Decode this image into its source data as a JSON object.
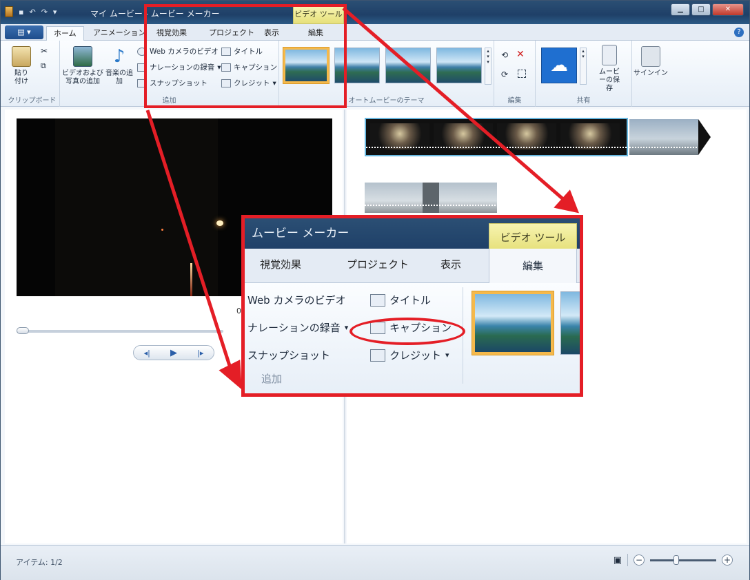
{
  "window": {
    "title": "マイ ムービー - ムービー メーカー",
    "context_tab": "ビデオ ツール"
  },
  "tabs": {
    "file": "▤ ▾",
    "home": "ホーム",
    "animation": "アニメーション",
    "visual_effects": "視覚効果",
    "project": "プロジェクト",
    "view": "表示",
    "edit": "編集"
  },
  "ribbon": {
    "clipboard": {
      "paste": "貼り付け",
      "label": "クリップボード"
    },
    "add": {
      "add_video_photos": "ビデオおよび写真の追加",
      "add_music": "音楽の追加",
      "webcam_video": "Web カメラのビデオ",
      "record_narration": "ナレーションの録音",
      "snapshot": "スナップショット",
      "title": "タイトル",
      "caption": "キャプション",
      "credits": "クレジット",
      "label": "追加"
    },
    "themes": {
      "label": "オートムービーのテーマ"
    },
    "editing": {
      "label": "編集"
    },
    "share": {
      "save_movie": "ムービーの保存",
      "sign_in": "サインイン",
      "label": "共有"
    }
  },
  "player": {
    "timecode": "00"
  },
  "status": {
    "items": "アイテム: 1/2"
  },
  "zoomed_callout": {
    "title": "ムービー メーカー",
    "context_tab": "ビデオ ツール",
    "tabs": [
      "視覚効果",
      "プロジェクト",
      "表示",
      "編集"
    ],
    "rows": {
      "webcam_video": "Web カメラのビデオ",
      "record_narration": "ナレーションの録音",
      "snapshot": "スナップショット",
      "title": "タイトル",
      "caption": "キャプション",
      "credits": "クレジット"
    },
    "group_label": "追加"
  },
  "colors": {
    "annotation_red": "#e41e26",
    "title_bar": "#1f4068",
    "context_yellow": "#e6e07a"
  }
}
